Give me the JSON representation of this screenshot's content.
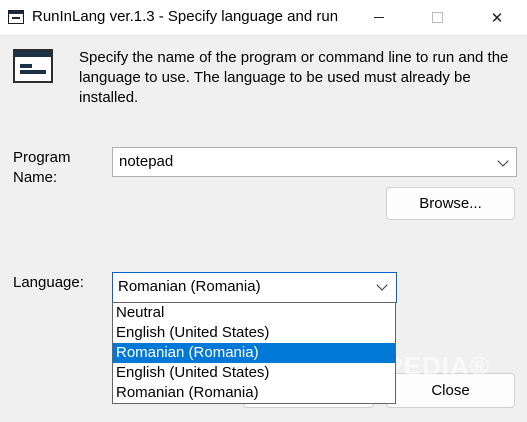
{
  "window": {
    "title": "RunInLang ver.1.3 - Specify language and run",
    "minimize_glyph": "",
    "close_glyph": "✕"
  },
  "description": "Specify the name of the program or command line to run and the language to use. The language to be used must already be installed.",
  "program": {
    "label": "Program Name:",
    "value": "notepad"
  },
  "browse_label": "Browse...",
  "language": {
    "label": "Language:",
    "selected": "Romanian (Romania)",
    "options": [
      "Neutral",
      "English (United States)",
      "Romanian (Romania)",
      "English (United States)",
      "Romanian (Romania)"
    ],
    "highlighted_index": 2
  },
  "close_label": "Close",
  "watermark": "SOFTPEDIA®",
  "colors": {
    "selection": "#0078d7",
    "focus_border": "#0066cc"
  }
}
